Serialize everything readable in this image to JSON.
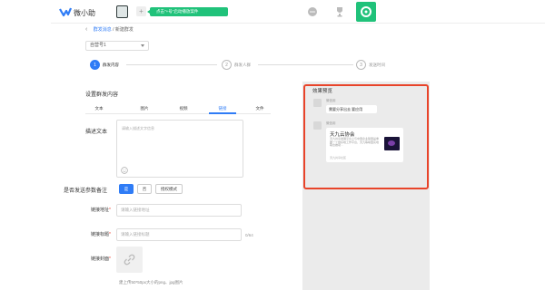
{
  "app": {
    "name": "微小助",
    "promo": "点击\"+号\"启动播放案件"
  },
  "breadcrumb": {
    "back": "‹",
    "parent": "群发消息",
    "separator": " / ",
    "current": "新建群发"
  },
  "selector": {
    "value": "自营号1"
  },
  "steps": [
    {
      "num": "1",
      "label": "群发内容"
    },
    {
      "num": "2",
      "label": "群发人群"
    },
    {
      "num": "3",
      "label": "发送时间"
    }
  ],
  "form": {
    "section_title": "设置群发内容",
    "tabs": [
      "文本",
      "图片",
      "视频",
      "链接",
      "文件"
    ],
    "desc_label": "描述文本",
    "desc_placeholder": "请输入描述文字信息",
    "remark_label": "是否发送参数备注",
    "remark_options": [
      "是",
      "否",
      "授权模式"
    ],
    "link_url_label": "链接地址",
    "link_url_placeholder": "请输入链接地址",
    "link_title_label": "链接标题",
    "link_title_placeholder": "请输入链接标题",
    "link_title_counter": "0/64",
    "link_cover_label": "链接封面",
    "upload_tip": "建上传50*50px大小的png、jpg图片",
    "required_mark": "*"
  },
  "preview": {
    "title": "效果预览",
    "msg1_name": "微信用",
    "msg1_text": "需要分享出去 要应用",
    "msg2_name": "微信用",
    "card_title": "天九云协会",
    "card_desc": "天九共享发展平台上与中国企业联盟是重要一个很好地工作平台，天九等联盟实地联合推动…",
    "card_source": "天九共享社区"
  },
  "colors": {
    "accent": "#2f7cf6",
    "brand": "#20c27a",
    "highlight": "#e8442a"
  }
}
